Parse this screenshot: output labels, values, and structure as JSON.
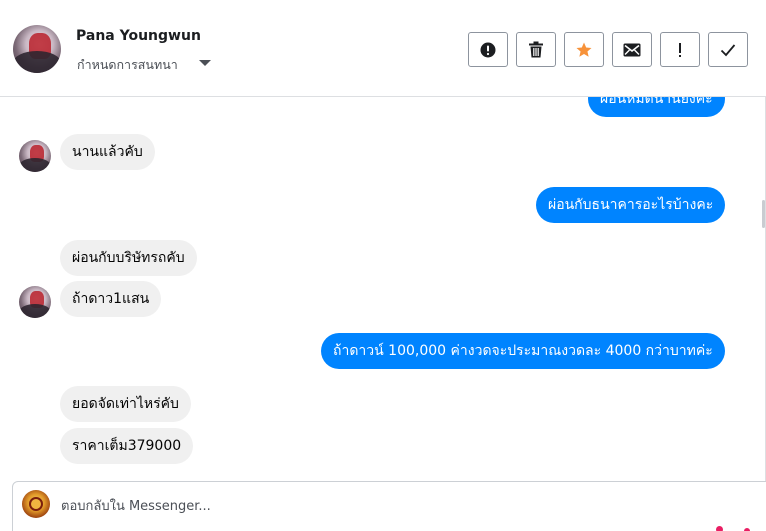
{
  "header": {
    "contact_name": "Pana Youngwun",
    "conversation_setting": "กำหนดการสนทนา"
  },
  "toolbar": [
    {
      "name": "spam-button",
      "icon": "exclamation-circle-icon"
    },
    {
      "name": "delete-button",
      "icon": "trash-icon"
    },
    {
      "name": "star-button",
      "icon": "star-icon",
      "color": "#f7923a"
    },
    {
      "name": "mark-unread-button",
      "icon": "envelope-icon"
    },
    {
      "name": "follow-up-button",
      "icon": "exclamation-icon"
    },
    {
      "name": "mark-done-button",
      "icon": "checkmark-icon"
    }
  ],
  "messages": [
    {
      "from": "page",
      "text": "ผ่อนหมดนานยังคะ"
    },
    {
      "from": "user",
      "text": "นานแล้วคับ"
    },
    {
      "from": "page",
      "text": "ผ่อนกับธนาคารอะไรบ้างคะ"
    },
    {
      "from": "user",
      "text": "ผ่อนกับบริษัทรถคับ"
    },
    {
      "from": "user",
      "text": "ถ้าดาว1แสน"
    },
    {
      "from": "page",
      "text": "ถ้าดาวน์ 100,000 ค่างวดจะประมาณงวดละ 4000 กว่าบาทค่ะ"
    },
    {
      "from": "user",
      "text": "ยอดจัดเท่าไหร่คับ"
    },
    {
      "from": "user",
      "text": "ราคาเต็ม379000"
    }
  ],
  "composer": {
    "placeholder": "ตอบกลับใน Messenger..."
  },
  "colors": {
    "outgoing_bubble": "#0084ff",
    "incoming_bubble": "#f0f0f0",
    "star": "#f7923a"
  }
}
